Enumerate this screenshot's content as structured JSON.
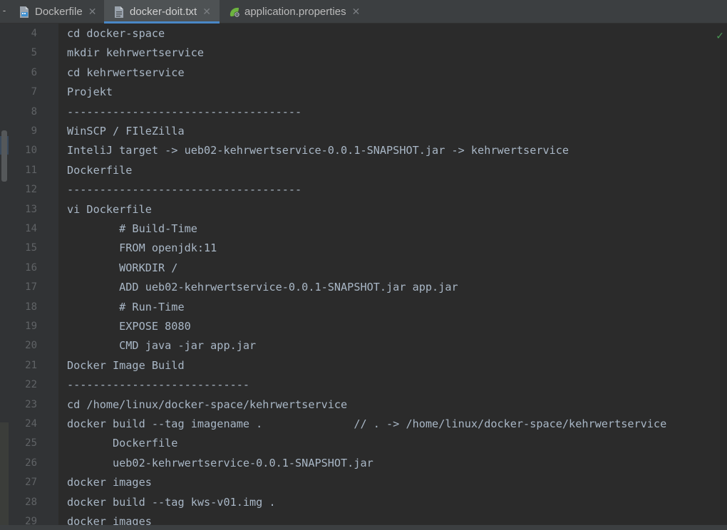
{
  "tabs": [
    {
      "label": "Dockerfile",
      "icon": "docker-file-icon",
      "active": false
    },
    {
      "label": "docker-doit.txt",
      "icon": "text-file-icon",
      "active": true
    },
    {
      "label": "application.properties",
      "icon": "spring-properties-icon",
      "active": false
    }
  ],
  "close_glyph": "✕",
  "colors": {
    "accent": "#4a88c7",
    "text": "#a9b7c6",
    "line_number": "#606366",
    "background": "#2b2b2b",
    "typo_underline": "#5a9e5a"
  },
  "editor": {
    "lines": [
      {
        "num": "4",
        "text": "cd docker-space"
      },
      {
        "num": "5",
        "text": "mkdir kehrwertservice"
      },
      {
        "num": "6",
        "text": "cd kehrwertservice"
      },
      {
        "num": "7",
        "text": "Projekt"
      },
      {
        "num": "8",
        "text": "------------------------------------"
      },
      {
        "num": "9",
        "text": "WinSCP / FIleZilla"
      },
      {
        "num": "10",
        "text": "InteliJ target -> ueb02-kehrwertservice-0.0.1-SNAPSHOT.jar -> kehrwertservice"
      },
      {
        "num": "11",
        "text": "Dockerfile"
      },
      {
        "num": "12",
        "text": "------------------------------------"
      },
      {
        "num": "13",
        "text": "vi Dockerfile"
      },
      {
        "num": "14",
        "text": "        # Build-Time"
      },
      {
        "num": "15",
        "text": "        FROM openjdk:11"
      },
      {
        "num": "16",
        "text": "        WORKDIR /"
      },
      {
        "num": "17",
        "text": "        ADD ueb02-kehrwertservice-0.0.1-SNAPSHOT.jar app.jar"
      },
      {
        "num": "18",
        "text": "        # Run-Time"
      },
      {
        "num": "19",
        "text": "        EXPOSE 8080"
      },
      {
        "num": "20",
        "text": "        CMD java -jar app.jar"
      },
      {
        "num": "21",
        "text": "Docker Image Build"
      },
      {
        "num": "22",
        "text": "----------------------------"
      },
      {
        "num": "23",
        "text": "cd /home/linux/docker-space/kehrwertservice"
      },
      {
        "num": "24",
        "text": "docker build --tag imagename .              // . -> /home/linux/docker-space/kehrwertservice"
      },
      {
        "num": "25",
        "text": "       Dockerfile"
      },
      {
        "num": "26",
        "text": "       ueb02-kehrwertservice-0.0.1-SNAPSHOT.jar"
      },
      {
        "num": "27",
        "text": "docker images"
      },
      {
        "num": "28",
        "text": "docker build --tag kws-v01.img ."
      },
      {
        "num": "29",
        "text": "docker images"
      }
    ]
  },
  "status": {
    "inspection_ok_icon": "checkmark-icon",
    "inspection_glyph": "✓"
  }
}
